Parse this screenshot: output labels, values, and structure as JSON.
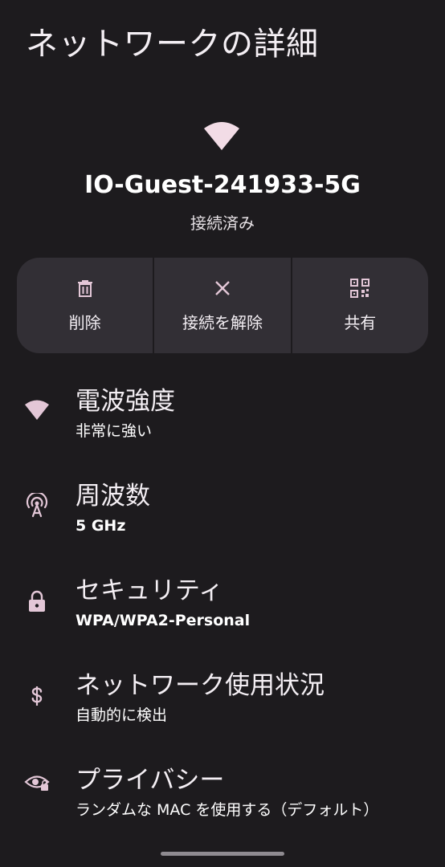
{
  "header": {
    "title": "ネットワークの詳細"
  },
  "network": {
    "name": "IO-Guest-241933-5G",
    "status": "接続済み"
  },
  "actions": {
    "delete": "削除",
    "disconnect": "接続を解除",
    "share": "共有"
  },
  "details": {
    "signal": {
      "title": "電波強度",
      "value": "非常に強い"
    },
    "frequency": {
      "title": "周波数",
      "value": "5 GHz"
    },
    "security": {
      "title": "セキュリティ",
      "value": "WPA/WPA2-Personal"
    },
    "usage": {
      "title": "ネットワーク使用状況",
      "value": "自動的に検出"
    },
    "privacy": {
      "title": "プライバシー",
      "value": "ランダムな MAC を使用する（デフォルト）"
    }
  },
  "colors": {
    "background": "#1d1b1e",
    "card": "#322f35",
    "accent": "#f2dce6",
    "icon": "#e3c7d7"
  },
  "icons": [
    "wifi-icon",
    "trash-icon",
    "close-icon",
    "qr-code-icon",
    "antenna-icon",
    "lock-icon",
    "dollar-icon",
    "privacy-eye-icon"
  ]
}
